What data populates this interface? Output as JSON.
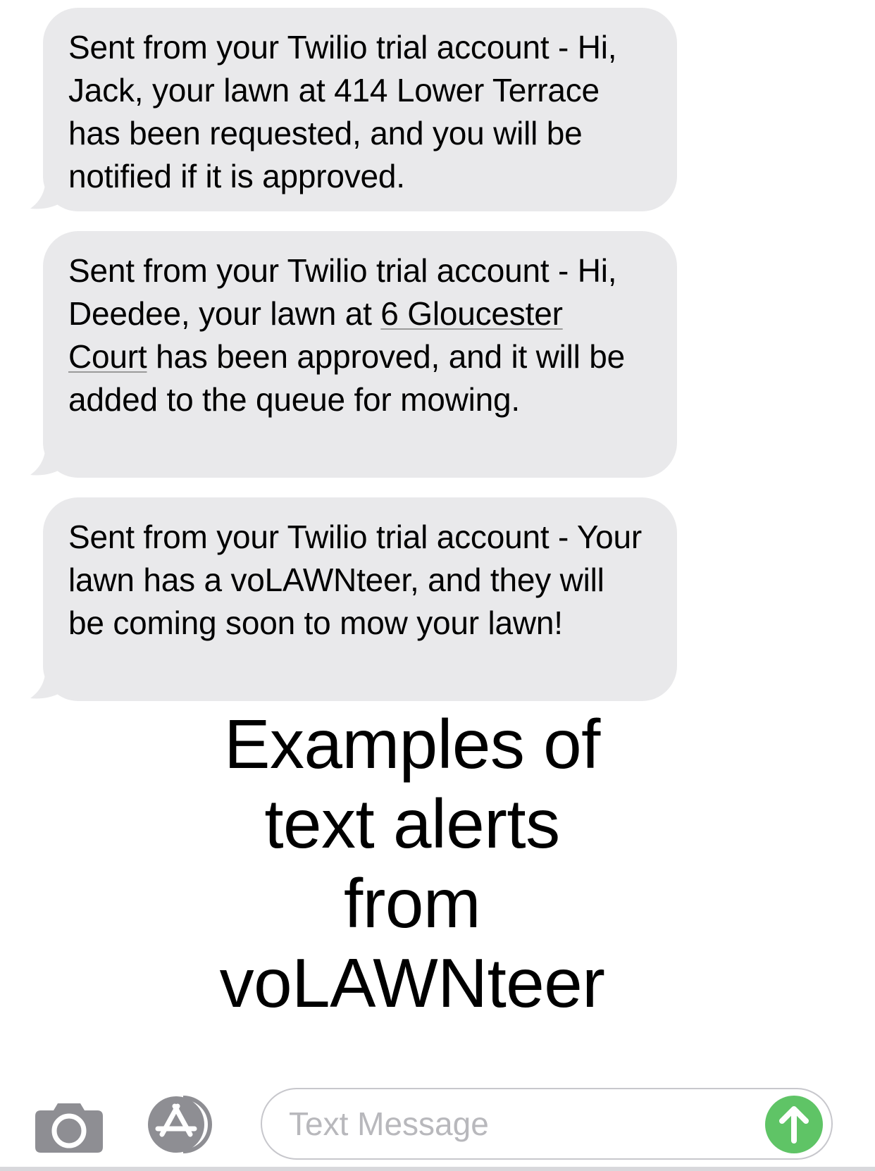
{
  "messages": [
    {
      "text_before": "Sent from your Twilio trial account - Hi, Jack, your lawn at 414 Lower Terrace has been requested, and you will be notified if it is approved.",
      "link": "",
      "text_after": ""
    },
    {
      "text_before": "Sent from your Twilio trial account - Hi, Deedee, your lawn at ",
      "link": "6 Gloucester Court",
      "text_after": " has been approved, and it will be added to the queue for mowing."
    },
    {
      "text_before": "Sent from your Twilio trial account - Your lawn has a voLAWNteer, and they will be coming soon to mow your lawn!",
      "link": "",
      "text_after": ""
    }
  ],
  "caption": "Examples of\ntext alerts\nfrom\nvoLAWNteer",
  "composer": {
    "placeholder": "Text Message",
    "camera_icon": "camera-icon",
    "apps_icon": "app-store-icon",
    "send_icon": "arrow-up-icon",
    "send_color": "#5fc466"
  },
  "colors": {
    "bubble_gray": "#e9e9eb",
    "placeholder_gray": "#b8b8bc",
    "icon_gray": "#8e8e93"
  }
}
